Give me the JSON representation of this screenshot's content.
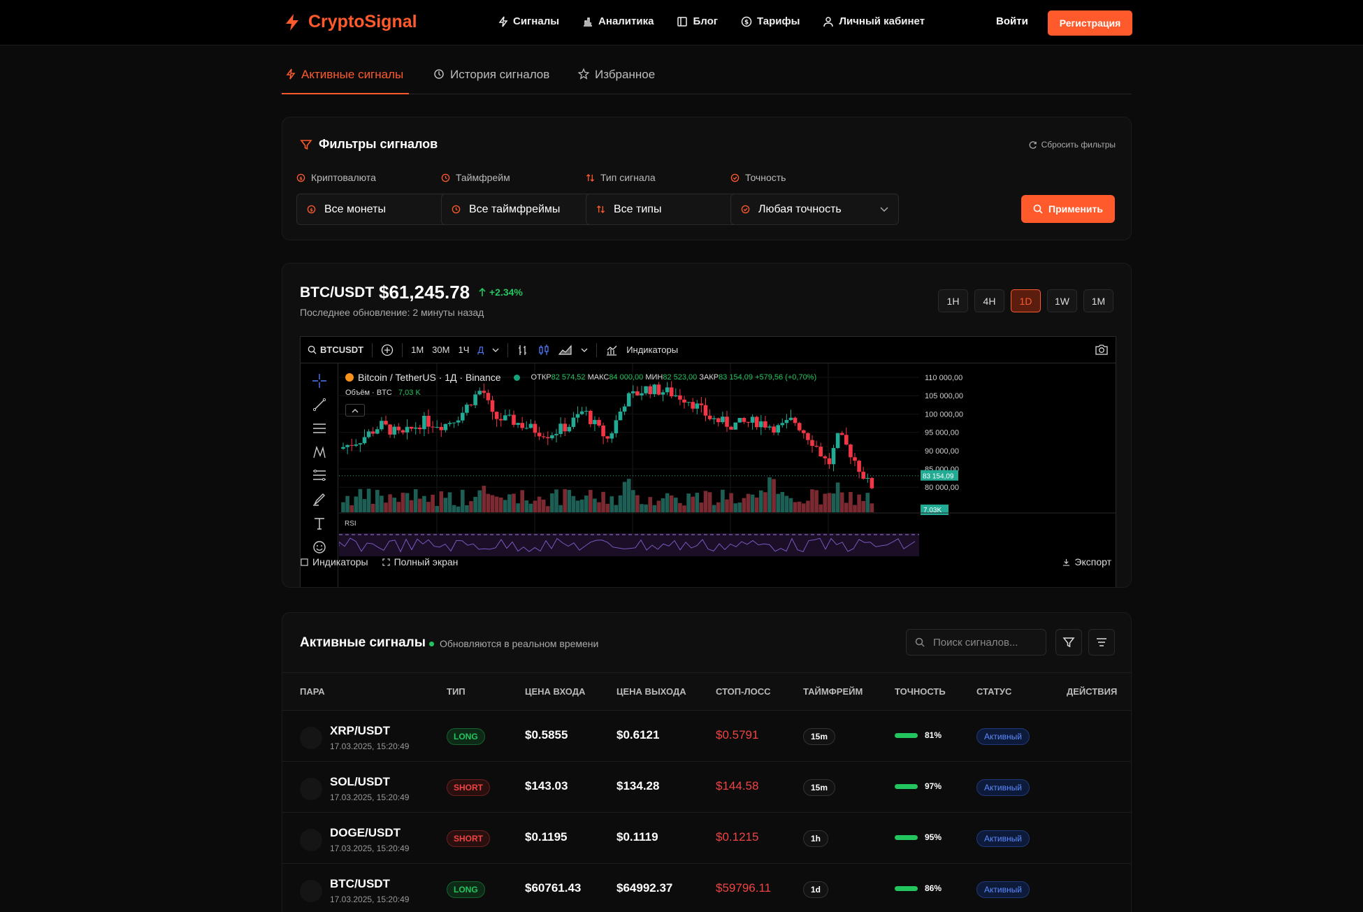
{
  "header": {
    "logo_text": "CryptoSignal",
    "nav": [
      {
        "label": "Сигналы",
        "icon": "bolt-icon"
      },
      {
        "label": "Аналитика",
        "icon": "bar-chart-icon"
      },
      {
        "label": "Блог",
        "icon": "book-icon"
      },
      {
        "label": "Тарифы",
        "icon": "dollar-icon"
      },
      {
        "label": "Личный кабинет",
        "icon": "user-icon"
      }
    ],
    "login": "Войти",
    "register": "Регистрация"
  },
  "tabs": [
    {
      "label": "Активные сигналы",
      "icon": "bolt-icon",
      "active": true
    },
    {
      "label": "История сигналов",
      "icon": "clock-icon",
      "active": false
    },
    {
      "label": "Избранное",
      "icon": "star-icon",
      "active": false
    }
  ],
  "filters": {
    "title": "Фильтры сигналов",
    "reset": "Сбросить фильтры",
    "groups": [
      {
        "label": "Криптовалюта",
        "value": "Все монеты"
      },
      {
        "label": "Таймфрейм",
        "value": "Все таймфреймы"
      },
      {
        "label": "Тип сигнала",
        "value": "Все типы"
      },
      {
        "label": "Точность",
        "value": "Любая точность"
      }
    ],
    "apply": "Применить"
  },
  "chart_card": {
    "pair": "BTC/USDT",
    "price": "$61,245.78",
    "change": "+2.34%",
    "updated": "Последнее обновление: 2 минуты назад",
    "timeframes": [
      "1H",
      "4H",
      "1D",
      "1W",
      "1M"
    ],
    "active_timeframe": "1D"
  },
  "tv": {
    "symbol": "BTCUSDT",
    "intervals": [
      "1М",
      "30М",
      "1Ч",
      "Д"
    ],
    "indicators": "Индикаторы",
    "title": "Bitcoin / TetherUS · 1Д · Binance",
    "ohlc": {
      "open_label": "ОТКР",
      "open": "82 574,52",
      "high_label": "МАКС",
      "high": "84 000,00",
      "low_label": "МИН",
      "low": "82 523,00",
      "close_label": "ЗАКР",
      "close": "83 154,09",
      "change": "+579,56 (+0,70%)"
    },
    "volume_label": "Объём · BTC",
    "volume_value": "7,03 K",
    "last_price_tag": "83 154,09",
    "volume_tag": "7,03K",
    "y_ticks": [
      "110 000,00",
      "105 000,00",
      "100 000,00",
      "95 000,00",
      "90 000,00",
      "85 000,00",
      "80 000,00"
    ],
    "bottom_indicators": "Индикаторы",
    "fullscreen": "Полный экран",
    "export": "Экспорт",
    "rsi_label": "RSI"
  },
  "signals": {
    "title": "Активные сигналы",
    "live": "Обновляются в реальном времени",
    "search_placeholder": "Поиск сигналов...",
    "columns": [
      "ПАРА",
      "ТИП",
      "ЦЕНА ВХОДА",
      "ЦЕНА ВЫХОДА",
      "СТОП-ЛОСС",
      "ТАЙМФРЕЙМ",
      "ТОЧНОСТЬ",
      "СТАТУС",
      "ДЕЙСТВИЯ"
    ],
    "rows": [
      {
        "pair": "XRP/USDT",
        "date": "17.03.2025, 15:20:49",
        "type": "LONG",
        "entry": "$0.5855",
        "exit": "$0.6121",
        "stop": "$0.5791",
        "tf": "15m",
        "acc": "81%",
        "status": "Активный"
      },
      {
        "pair": "SOL/USDT",
        "date": "17.03.2025, 15:20:49",
        "type": "SHORT",
        "entry": "$143.03",
        "exit": "$134.28",
        "stop": "$144.58",
        "tf": "15m",
        "acc": "97%",
        "status": "Активный"
      },
      {
        "pair": "DOGE/USDT",
        "date": "17.03.2025, 15:20:49",
        "type": "SHORT",
        "entry": "$0.1195",
        "exit": "$0.1119",
        "stop": "$0.1215",
        "tf": "1h",
        "acc": "95%",
        "status": "Активный"
      },
      {
        "pair": "BTC/USDT",
        "date": "17.03.2025, 15:20:49",
        "type": "LONG",
        "entry": "$60761.43",
        "exit": "$64992.37",
        "stop": "$59796.11",
        "tf": "1d",
        "acc": "86%",
        "status": "Активный"
      }
    ]
  },
  "colors": {
    "accent": "#ff5a2c",
    "up": "#22c55e",
    "down": "#ef4444",
    "status_blue": "#5b8cff"
  }
}
